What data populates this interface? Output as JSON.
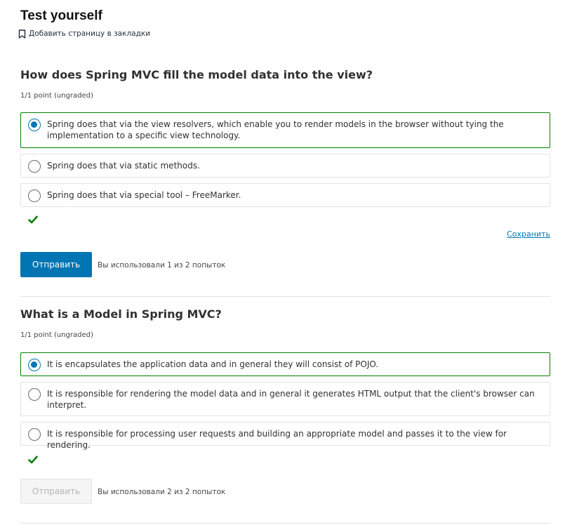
{
  "header": {
    "title": "Test yourself",
    "bookmark_label": "Добавить страницу в закладки"
  },
  "problems": [
    {
      "question": "How does Spring MVC fill the model data into the view?",
      "points": "1/1 point (ungraded)",
      "choices": [
        {
          "label": "Spring does that via the view resolvers, which enable you to render models in the browser without tying the implementation to a specific view technology.",
          "selected": true
        },
        {
          "label": "Spring does that via static methods.",
          "selected": false
        },
        {
          "label": "Spring does that via special tool – FreeMarker.",
          "selected": false
        }
      ],
      "status": "correct",
      "save_label": "Сохранить",
      "submit_label": "Отправить",
      "submit_enabled": true,
      "attempts_text": "Вы использовали 1 из 2 попыток"
    },
    {
      "question": "What is a Model in Spring MVC?",
      "points": "1/1 point (ungraded)",
      "choices": [
        {
          "label": "It is encapsulates the application data and in general they will consist of POJO.",
          "selected": true
        },
        {
          "label": "It is responsible for rendering the model data and in general it generates HTML output that the client's browser can interpret.",
          "selected": false
        },
        {
          "label": "It is responsible for processing user requests and building an appropriate model and passes it to the view for rendering.",
          "selected": false
        }
      ],
      "status": "correct",
      "submit_label": "Отправить",
      "submit_enabled": false,
      "attempts_text": "Вы использовали 2 из 2 попыток"
    }
  ],
  "colors": {
    "accent": "#0075b4",
    "correct": "#008100",
    "border": "#e2e2e2"
  },
  "icons": {
    "bookmark": "bookmark-icon",
    "check": "checkmark-icon",
    "radio": "radio-button"
  }
}
